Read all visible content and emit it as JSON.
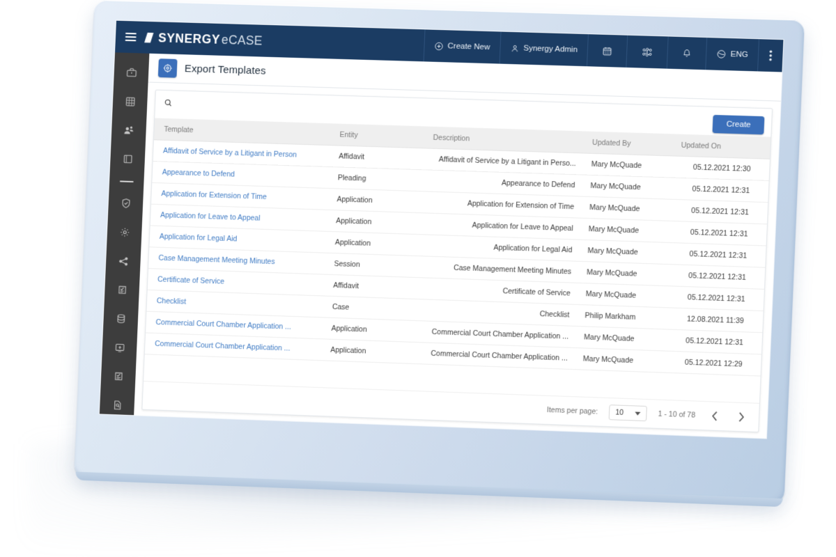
{
  "appbar": {
    "menu_icon": "hamburger-icon",
    "brand_primary": "SYNERGY",
    "brand_secondary": "eCASE",
    "nav": [
      {
        "name": "create-new",
        "label": "Create New",
        "icon": "plus-circle-icon"
      },
      {
        "name": "user-account",
        "label": "Synergy Admin",
        "icon": "user-icon"
      },
      {
        "name": "calendar",
        "label": "",
        "icon": "calendar-icon"
      },
      {
        "name": "apps",
        "label": "",
        "icon": "apps-grid-icon"
      },
      {
        "name": "notifications",
        "label": "",
        "icon": "bell-icon"
      },
      {
        "name": "language",
        "label": "ENG",
        "icon": "globe-icon"
      },
      {
        "name": "more-options",
        "label": "",
        "icon": "vertical-dots-icon"
      }
    ]
  },
  "sidebar": {
    "items": [
      {
        "name": "sidebar-item-briefcase",
        "icon": "briefcase-icon"
      },
      {
        "name": "sidebar-item-building",
        "icon": "building-icon"
      },
      {
        "name": "sidebar-item-contacts",
        "icon": "contacts-icon"
      },
      {
        "name": "sidebar-item-book",
        "icon": "book-icon"
      },
      {
        "name": "sidebar-divider",
        "icon": "divider"
      },
      {
        "name": "sidebar-item-security",
        "icon": "shield-check-icon"
      },
      {
        "name": "sidebar-item-settings",
        "icon": "gear-icon"
      },
      {
        "name": "sidebar-item-workflow",
        "icon": "workflow-icon"
      },
      {
        "name": "sidebar-item-tasks",
        "icon": "clipboard-check-icon"
      },
      {
        "name": "sidebar-item-database",
        "icon": "database-icon"
      },
      {
        "name": "sidebar-item-add-screen",
        "icon": "add-screen-icon"
      },
      {
        "name": "sidebar-item-forms",
        "icon": "form-check-icon"
      },
      {
        "name": "sidebar-item-reports",
        "icon": "document-search-icon"
      }
    ]
  },
  "page": {
    "title": "Export Templates",
    "title_icon": "gear-target-icon"
  },
  "search": {
    "icon": "search-icon",
    "value": "",
    "placeholder": ""
  },
  "toolbar": {
    "create_label": "Create"
  },
  "table": {
    "columns": [
      {
        "key": "template",
        "label": "Template"
      },
      {
        "key": "entity",
        "label": "Entity"
      },
      {
        "key": "description",
        "label": "Description"
      },
      {
        "key": "updated_by",
        "label": "Updated By"
      },
      {
        "key": "updated_on",
        "label": "Updated On"
      }
    ],
    "rows": [
      {
        "template": "Affidavit of Service by a Litigant in Person",
        "entity": "Affidavit",
        "description": "Affidavit of Service by a Litigant in Perso...",
        "updated_by": "Mary McQuade",
        "updated_on": "05.12.2021 12:30"
      },
      {
        "template": "Appearance to Defend",
        "entity": "Pleading",
        "description": "Appearance to Defend",
        "updated_by": "Mary McQuade",
        "updated_on": "05.12.2021 12:31"
      },
      {
        "template": "Application for Extension of Time",
        "entity": "Application",
        "description": "Application for Extension of Time",
        "updated_by": "Mary McQuade",
        "updated_on": "05.12.2021 12:31"
      },
      {
        "template": "Application for Leave to Appeal",
        "entity": "Application",
        "description": "Application for Leave to Appeal",
        "updated_by": "Mary McQuade",
        "updated_on": "05.12.2021 12:31"
      },
      {
        "template": "Application for Legal Aid",
        "entity": "Application",
        "description": "Application for Legal Aid",
        "updated_by": "Mary McQuade",
        "updated_on": "05.12.2021 12:31"
      },
      {
        "template": "Case Management Meeting Minutes",
        "entity": "Session",
        "description": "Case Management Meeting Minutes",
        "updated_by": "Mary McQuade",
        "updated_on": "05.12.2021 12:31"
      },
      {
        "template": "Certificate of Service",
        "entity": "Affidavit",
        "description": "Certificate of Service",
        "updated_by": "Mary McQuade",
        "updated_on": "05.12.2021 12:31"
      },
      {
        "template": "Checklist",
        "entity": "Case",
        "description": "Checklist",
        "updated_by": "Philip Markham",
        "updated_on": "12.08.2021 11:39"
      },
      {
        "template": "Commercial Court Chamber Application ...",
        "entity": "Application",
        "description": "Commercial Court Chamber Application ...",
        "updated_by": "Mary McQuade",
        "updated_on": "05.12.2021 12:31"
      },
      {
        "template": "Commercial Court Chamber Application ...",
        "entity": "Application",
        "description": "Commercial Court Chamber Application ...",
        "updated_by": "Mary McQuade",
        "updated_on": "05.12.2021 12:29"
      }
    ]
  },
  "paginator": {
    "items_per_page_label": "Items per page:",
    "items_per_page_value": "10",
    "range_label": "1 - 10 of 78",
    "prev_icon": "chevron-left-icon",
    "next_icon": "chevron-right-icon"
  },
  "colors": {
    "appbar_bg": "#1b3c63",
    "sidebar_bg": "#3d3d3d",
    "accent": "#3b6fba",
    "link": "#3f7bc4",
    "bezel": "#d5e2f0"
  }
}
